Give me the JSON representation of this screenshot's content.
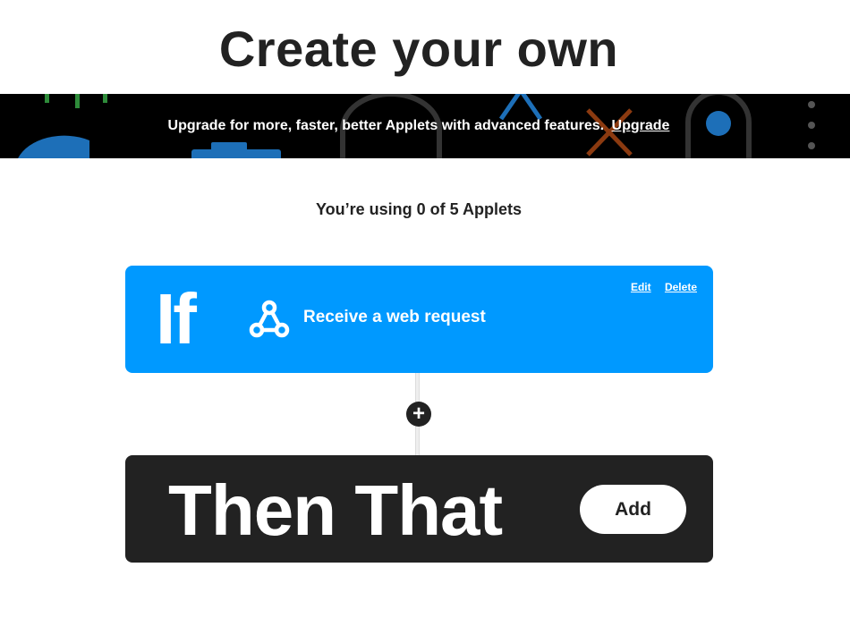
{
  "page": {
    "title": "Create your own"
  },
  "banner": {
    "text": "Upgrade for more, faster, better Applets with advanced features.",
    "link_label": "Upgrade"
  },
  "usage": {
    "text": "You’re using 0 of 5 Applets"
  },
  "if_card": {
    "keyword": "If",
    "trigger_label": "Receive a web request",
    "edit_label": "Edit",
    "delete_label": "Delete",
    "icon": "webhook-icon",
    "color": "#0099ff"
  },
  "connector": {
    "add_symbol": "+"
  },
  "then_card": {
    "keyword": "Then That",
    "add_label": "Add",
    "color": "#222222"
  }
}
